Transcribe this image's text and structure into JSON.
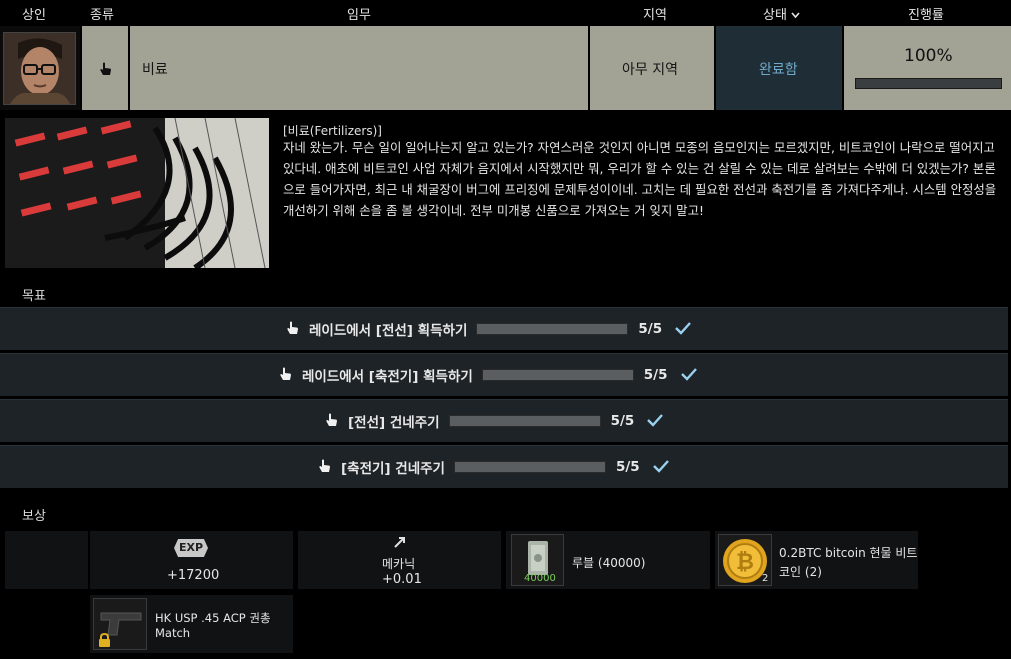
{
  "header": {
    "trader": "상인",
    "type": "종류",
    "quest": "임무",
    "region": "지역",
    "status": "상태",
    "progress": "진행률"
  },
  "quest": {
    "name": "비료",
    "region": "아무 지역",
    "status": "완료함",
    "progress_text": "100%",
    "progress_value": 1.0
  },
  "briefing": {
    "title": "[비료(Fertilizers)]",
    "body": "자네 왔는가. 무슨 일이 일어나는지 알고 있는가? 자연스러운 것인지 아니면 모종의 음모인지는 모르겠지만, 비트코인이 나락으로 떨어지고 있다네. 애초에 비트코인 사업 자체가 음지에서 시작했지만 뭐, 우리가 할 수 있는 건 살릴 수 있는 데로 살려보는 수밖에 더 있겠는가? 본론으로 들어가자면, 최근 내 채굴장이 버그에 프리징에 문제투성이이네. 고치는 데 필요한 전선과 축전기를 좀 가져다주게나. 시스템 안정성을 개선하기 위해 손을 좀 볼 생각이네. 전부 미개봉 신품으로 가져오는 거 잊지 말고!"
  },
  "objectives_label": "목표",
  "objectives": [
    {
      "label": "레이드에서 [전선] 획득하기",
      "count": "5/5",
      "fill": 1.0
    },
    {
      "label": "레이드에서 [축전기] 획득하기",
      "count": "5/5",
      "fill": 1.0
    },
    {
      "label": "[전선] 건네주기",
      "count": "5/5",
      "fill": 1.0
    },
    {
      "label": "[축전기] 건네주기",
      "count": "5/5",
      "fill": 1.0
    }
  ],
  "rewards_label": "보상",
  "rewards": {
    "exp_badge": "EXP",
    "exp_value": "+17200",
    "skill_name": "메카닉",
    "skill_value": "+0.01",
    "roubles_label": "루블 (40000)",
    "roubles_slot": "40000",
    "bitcoin_label_1": "0.2BTC bitcoin 현물 비트",
    "bitcoin_label_2": "코인 (2)",
    "bitcoin_slot": "2",
    "pistol_label_1": "HK USP .45 ACP 권총",
    "pistol_label_2": "Match"
  },
  "colors": {
    "cell_bg": "#a2a295",
    "status_bg": "#1f2d36",
    "status_text": "#6fa8c8",
    "objective_bg": "#1d2327",
    "check": "#9ad1ee"
  },
  "icons": [
    "hand-pointer-icon",
    "chevron-down-icon",
    "check-icon",
    "exp-badge-icon",
    "skill-arrow-icon",
    "lock-icon",
    "bitcoin-icon",
    "cash-icon",
    "pistol-icon"
  ]
}
